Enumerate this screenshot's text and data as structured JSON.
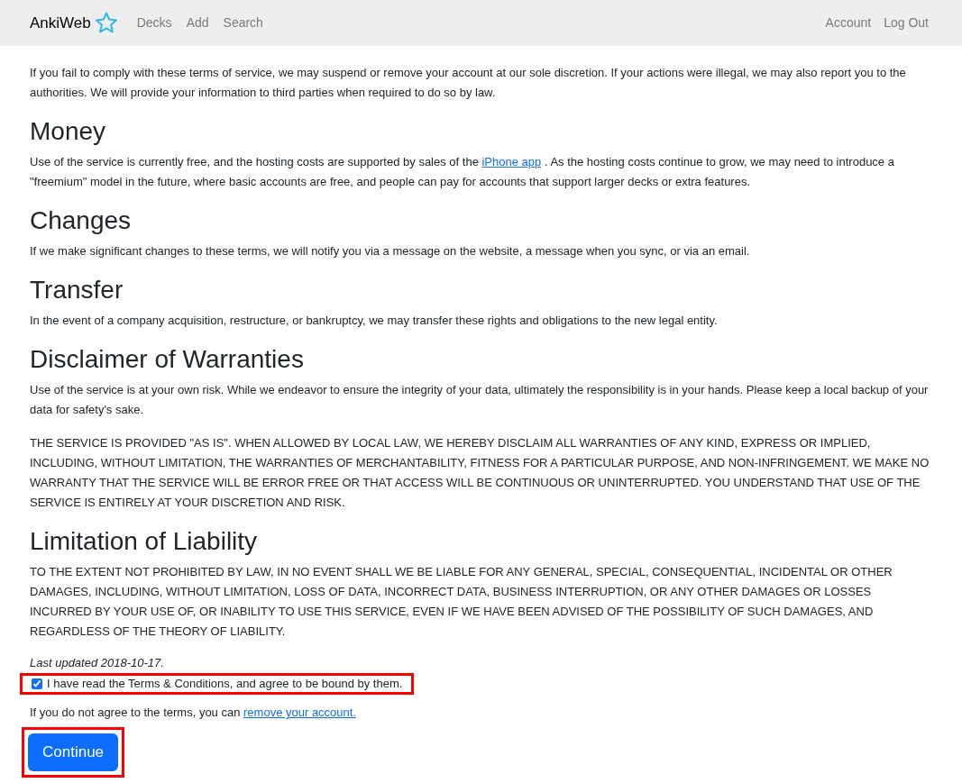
{
  "navbar": {
    "brand": "AnkiWeb",
    "links": [
      "Decks",
      "Add",
      "Search"
    ],
    "right_links": [
      "Account",
      "Log Out"
    ]
  },
  "sections": [
    {
      "paragraphs": [
        [
          {
            "text": "If you fail to comply with these terms of service, we may suspend or remove your account at our sole discretion. If your actions were illegal, we may also report you to the authorities. We will provide your information to third parties when required to do so by law."
          }
        ]
      ]
    },
    {
      "heading": "Money",
      "paragraphs": [
        [
          {
            "text": "Use of the service is currently free, and the hosting costs are supported by sales of the "
          },
          {
            "text": "iPhone app",
            "kind": "link"
          },
          {
            "text": " . As the hosting costs continue to grow, we may need to introduce a \"freemium\" model in the future, where basic accounts are free, and people can pay for accounts that support larger decks or extra features."
          }
        ]
      ]
    },
    {
      "heading": "Changes",
      "paragraphs": [
        [
          {
            "text": "If we make significant changes to these terms, we will notify you via a message on the website, a message when you sync, or via an email."
          }
        ]
      ]
    },
    {
      "heading": "Transfer",
      "paragraphs": [
        [
          {
            "text": "In the event of a company acquisition, restructure, or bankruptcy, we may transfer these rights and obligations to the new legal entity."
          }
        ]
      ]
    },
    {
      "heading": "Disclaimer of Warranties",
      "paragraphs": [
        [
          {
            "text": "Use of the service is at your own risk. While we endeavor to ensure the integrity of your data, ultimately the responsibility is in your hands. Please keep a local backup of your data for safety's sake."
          }
        ],
        [
          {
            "text": "THE SERVICE IS PROVIDED \"AS IS\". WHEN ALLOWED BY LOCAL LAW, WE HEREBY DISCLAIM ALL WARRANTIES OF ANY KIND, EXPRESS OR IMPLIED, INCLUDING, WITHOUT LIMITATION, THE WARRANTIES OF MERCHANTABILITY, FITNESS FOR A PARTICULAR PURPOSE, AND NON-INFRINGEMENT. WE MAKE NO WARRANTY THAT THE SERVICE WILL BE ERROR FREE OR THAT ACCESS WILL BE CONTINUOUS OR UNINTERRUPTED. YOU UNDERSTAND THAT USE OF THE SERVICE IS ENTIRELY AT YOUR DISCRETION AND RISK."
          }
        ]
      ]
    },
    {
      "heading": "Limitation of Liability",
      "paragraphs": [
        [
          {
            "text": "TO THE EXTENT NOT PROHIBITED BY LAW, IN NO EVENT SHALL WE BE LIABLE FOR ANY GENERAL, SPECIAL, CONSEQUENTIAL, INCIDENTAL OR OTHER DAMAGES, INCLUDING, WITHOUT LIMITATION, LOSS OF DATA, INCORRECT DATA, BUSINESS INTERRUPTION, OR ANY OTHER DAMAGES OR LOSSES INCURRED BY YOUR USE OF, OR INABILITY TO USE THIS SERVICE, EVEN IF WE HAVE BEEN ADVISED OF THE POSSIBILITY OF SUCH DAMAGES, AND REGARDLESS OF THE THEORY OF LIABILITY."
          }
        ]
      ]
    }
  ],
  "last_updated": "Last updated 2018-10-17.",
  "agreement": {
    "label": "I have read the Terms & Conditions, and agree to be bound by them.",
    "checked": true,
    "highlighted": true
  },
  "notice": {
    "text": "If you do not agree to the terms, you can ",
    "link": "remove your account."
  },
  "continue_button": {
    "label": "Continue",
    "highlighted": true
  }
}
